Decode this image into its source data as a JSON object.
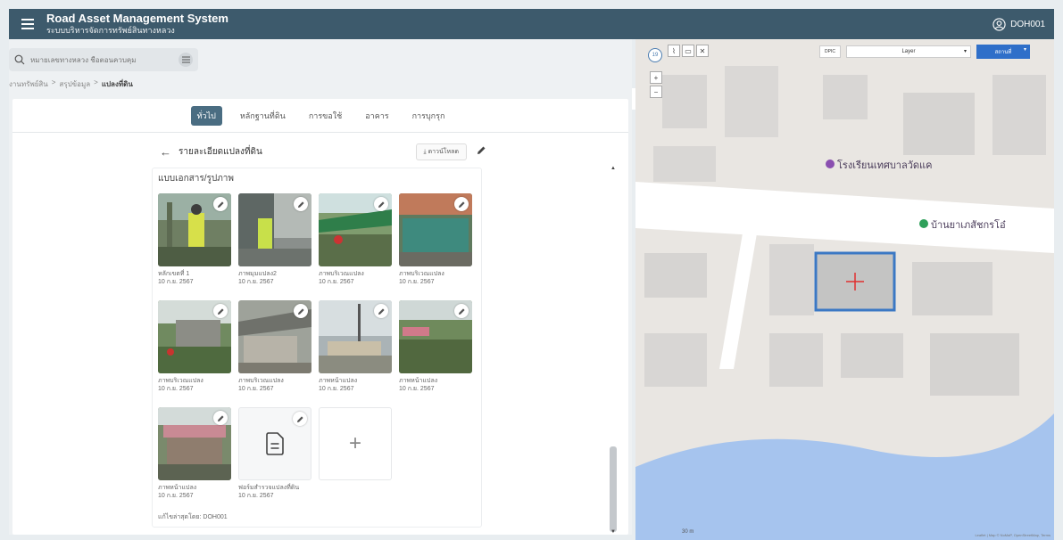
{
  "app": {
    "title": "Road Asset Management System",
    "subtitle": "ระบบบริหารจัดการทรัพย์สินทางหลวง",
    "user": "DOH001"
  },
  "search": {
    "placeholder": "หมายเลขทางหลวง ชื่อตอนควบคุม"
  },
  "breadcrumb": {
    "items": [
      "งานทรัพย์สิน",
      "สรุปข้อมูล"
    ],
    "separator": ">",
    "current": "แปลงที่ดิน"
  },
  "tabs": [
    {
      "label": "ทั่วไป",
      "active": true
    },
    {
      "label": "หลักฐานที่ดิน",
      "active": false
    },
    {
      "label": "การขอใช้",
      "active": false
    },
    {
      "label": "อาคาร",
      "active": false
    },
    {
      "label": "การบุกรุก",
      "active": false
    }
  ],
  "detail": {
    "back_label": "←",
    "title": "รายละเอียดแปลงที่ดิน",
    "download_label": "⤓ ดาวน์โหลด"
  },
  "documents": {
    "title": "แบบเอกสาร/รูปภาพ",
    "items": [
      {
        "name": "หลักเขตที่ 1",
        "date": "10 ก.ย. 2567"
      },
      {
        "name": "ภาพมุมแปลง2",
        "date": "10 ก.ย. 2567"
      },
      {
        "name": "ภาพบริเวณแปลง",
        "date": "10 ก.ย. 2567"
      },
      {
        "name": "ภาพบริเวณแปลง",
        "date": "10 ก.ย. 2567"
      },
      {
        "name": "ภาพบริเวณแปลง",
        "date": "10 ก.ย. 2567"
      },
      {
        "name": "ภาพบริเวณแปลง",
        "date": "10 ก.ย. 2567"
      },
      {
        "name": "ภาพหน้าแปลง",
        "date": "10 ก.ย. 2567"
      },
      {
        "name": "ภาพหน้าแปลง",
        "date": "10 ก.ย. 2567"
      },
      {
        "name": "ภาพหน้าแปลง",
        "date": "10 ก.ย. 2567"
      },
      {
        "name": "ฟอร์มสำรวจแปลงที่ดิน",
        "date": "10 ก.ย. 2567"
      }
    ],
    "add_label": "+",
    "updated_by": "แก้ไขล่าสุดโดย: DOH001"
  },
  "map": {
    "zoom": "19",
    "dpic_label": "DPIC",
    "layer_label": "Layer",
    "place_label": "สถานที่",
    "poi_school": "โรงเรียนเทศบาลวัดแค",
    "poi_pharmacy": "บ้านยาเภสัชกรโอ๋",
    "scale_label": "30 m",
    "attribution": "Leaflet | Map © NoMaP, OpenStreetMap, Terms",
    "water_color": "#a6c4ee",
    "parcel_color": "#3b78c4"
  },
  "colors": {
    "header_bg": "#3d5a6c",
    "tab_active": "#4a6d82"
  }
}
